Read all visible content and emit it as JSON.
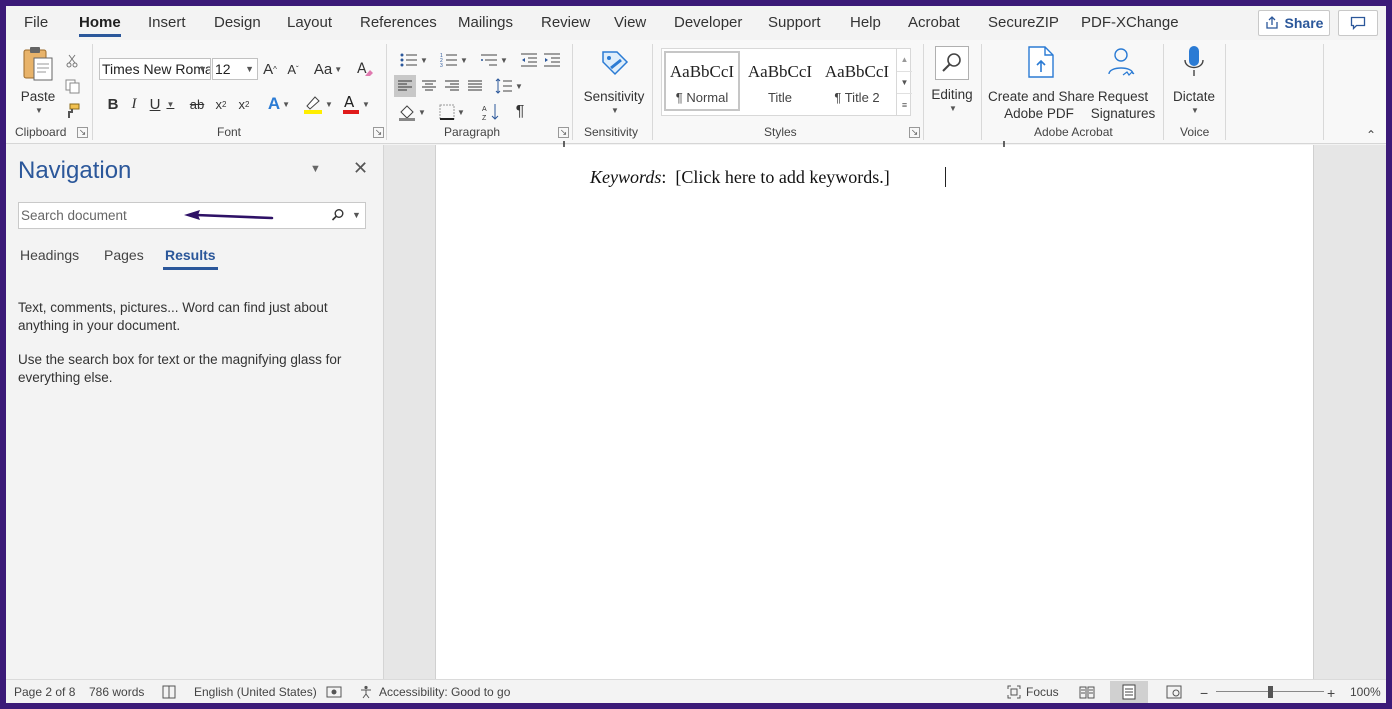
{
  "tabs": [
    "File",
    "Home",
    "Insert",
    "Design",
    "Layout",
    "References",
    "Mailings",
    "Review",
    "View",
    "Developer",
    "Support",
    "Help",
    "Acrobat",
    "SecureZIP",
    "PDF-XChange"
  ],
  "active_tab": "Home",
  "share_label": "Share",
  "ribbon": {
    "clipboard": {
      "label": "Clipboard",
      "paste": "Paste"
    },
    "font": {
      "label": "Font",
      "family": "Times New Roman",
      "size": "12"
    },
    "paragraph": {
      "label": "Paragraph"
    },
    "sensitivity": {
      "label": "Sensitivity",
      "button": "Sensitivity"
    },
    "styles": {
      "label": "Styles",
      "items": [
        {
          "sample": "AaBbCcI",
          "name": "¶ Normal"
        },
        {
          "sample": "AaBbCcI",
          "name": "Title"
        },
        {
          "sample": "AaBbCcI",
          "name": "¶ Title 2"
        }
      ]
    },
    "editing": {
      "label": "Editing"
    },
    "acrobat": {
      "label": "Adobe Acrobat",
      "create_line1": "Create and Share",
      "create_line2": "Adobe PDF",
      "request_line1": "Request",
      "request_line2": "Signatures"
    },
    "voice": {
      "label": "Voice",
      "dictate": "Dictate"
    }
  },
  "nav": {
    "title": "Navigation",
    "search_placeholder": "Search document",
    "tabs": [
      "Headings",
      "Pages",
      "Results"
    ],
    "active_tab": "Results",
    "msg1": "Text, comments, pictures... Word can find just about anything in your document.",
    "msg2": "Use the search box for text or the magnifying glass for everything else."
  },
  "document": {
    "keywords_label": "Keywords",
    "keywords_text": "[Click here to add keywords.]"
  },
  "status": {
    "page": "Page 2 of 8",
    "words": "786 words",
    "language": "English (United States)",
    "accessibility": "Accessibility: Good to go",
    "focus": "Focus",
    "zoom": "100%",
    "zoom_level": 0.5
  },
  "colors": {
    "accent": "#2b579a",
    "frame": "#3b1a78",
    "annotation_arrow": "#2e1166"
  }
}
